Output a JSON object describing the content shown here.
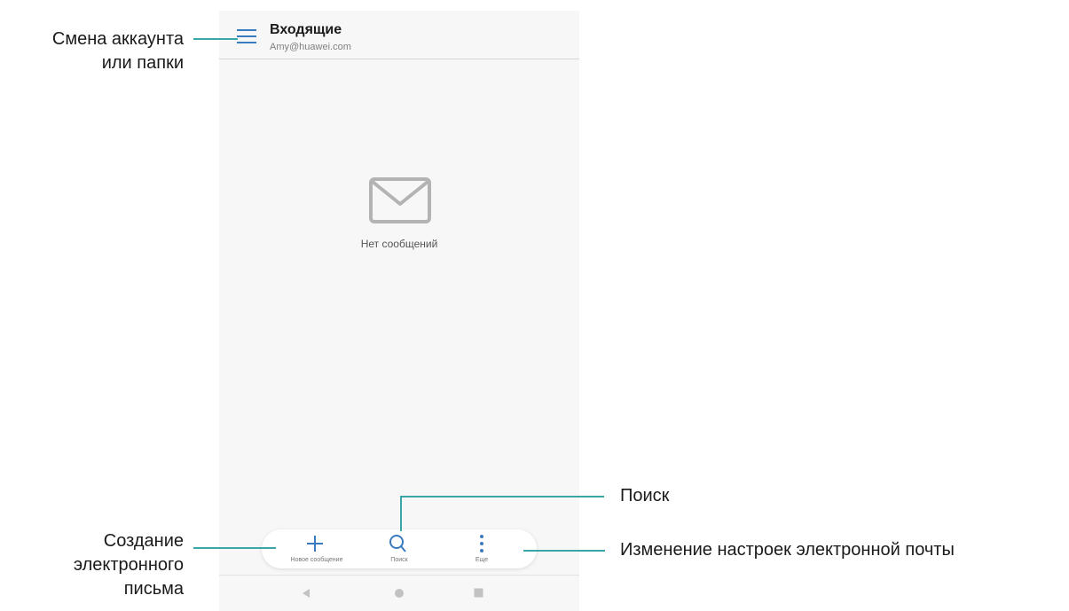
{
  "header": {
    "title": "Входящие",
    "account": "Amy@huawei.com",
    "menu_icon": "menu-icon"
  },
  "empty_state": {
    "icon": "envelope-icon",
    "text": "Нет сообщений"
  },
  "toolbar": {
    "compose": {
      "label": "Новое сообщение",
      "icon": "plus-icon"
    },
    "search": {
      "label": "Поиск",
      "icon": "search-icon"
    },
    "more": {
      "label": "Еще",
      "icon": "more-vertical-icon"
    }
  },
  "navbar": {
    "back_icon": "back-triangle-icon",
    "home_icon": "home-circle-icon",
    "recents_icon": "recents-square-icon"
  },
  "callouts": {
    "switch_account_line1": "Смена аккаунта",
    "switch_account_line2": "или папки",
    "compose_line1": "Создание",
    "compose_line2": "электронного",
    "compose_line3": "письма",
    "search": "Поиск",
    "settings": "Изменение настроек электронной почты"
  },
  "colors": {
    "accent": "#3aa6a6",
    "icon_blue": "#3a7bbf",
    "screen_bg": "#f7f7f7"
  }
}
